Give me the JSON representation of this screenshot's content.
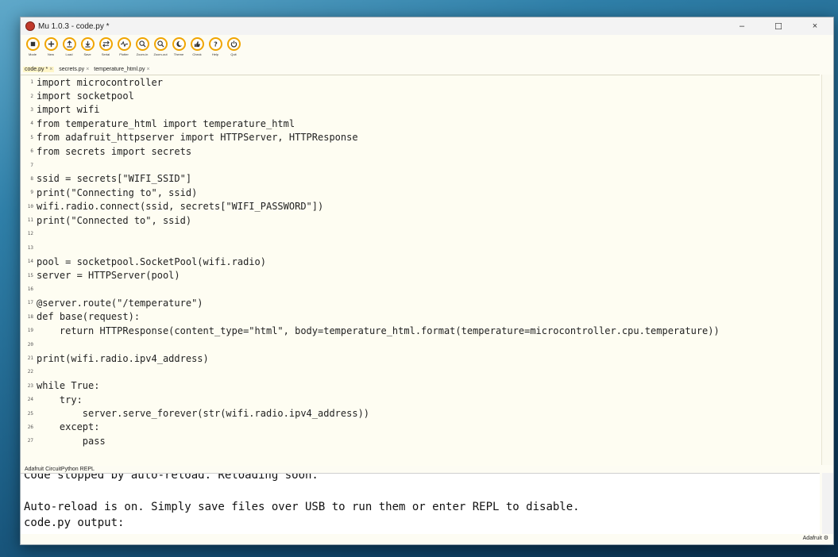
{
  "window": {
    "title": "Mu 1.0.3 - code.py *",
    "controls": [
      "–",
      "☐",
      "×"
    ]
  },
  "toolbar": [
    {
      "label": "Mode",
      "icon": "mode-icon"
    },
    {
      "label": "New",
      "icon": "plus-icon"
    },
    {
      "label": "Load",
      "icon": "load-icon"
    },
    {
      "label": "Save",
      "icon": "save-icon"
    },
    {
      "label": "Serial",
      "icon": "serial-icon"
    },
    {
      "label": "Plotter",
      "icon": "plotter-icon"
    },
    {
      "label": "Zoom-in",
      "icon": "zoom-in-icon"
    },
    {
      "label": "Zoom-out",
      "icon": "zoom-out-icon"
    },
    {
      "label": "Theme",
      "icon": "theme-icon"
    },
    {
      "label": "Check",
      "icon": "check-icon"
    },
    {
      "label": "Help",
      "icon": "help-icon"
    },
    {
      "label": "Quit",
      "icon": "quit-icon"
    }
  ],
  "tabs": [
    {
      "label": "code.py *"
    },
    {
      "label": "secrets.py"
    },
    {
      "label": "temperature_html.py"
    }
  ],
  "code": [
    {
      "n": "1",
      "text": "import microcontroller"
    },
    {
      "n": "2",
      "text": "import socketpool"
    },
    {
      "n": "3",
      "text": "import wifi"
    },
    {
      "n": "4",
      "text": "from temperature_html import temperature_html"
    },
    {
      "n": "5",
      "text": "from adafruit_httpserver import HTTPServer, HTTPResponse"
    },
    {
      "n": "6",
      "text": "from secrets import secrets"
    },
    {
      "n": "7",
      "text": ""
    },
    {
      "n": "8",
      "text": "ssid = secrets[\"WIFI_SSID\"]"
    },
    {
      "n": "9",
      "text": "print(\"Connecting to\", ssid)"
    },
    {
      "n": "10",
      "text": "wifi.radio.connect(ssid, secrets[\"WIFI_PASSWORD\"])"
    },
    {
      "n": "11",
      "text": "print(\"Connected to\", ssid)"
    },
    {
      "n": "12",
      "text": ""
    },
    {
      "n": "13",
      "text": ""
    },
    {
      "n": "14",
      "text": "pool = socketpool.SocketPool(wifi.radio)"
    },
    {
      "n": "15",
      "text": "server = HTTPServer(pool)"
    },
    {
      "n": "16",
      "text": ""
    },
    {
      "n": "17",
      "text": "@server.route(\"/temperature\")"
    },
    {
      "n": "18",
      "text": "def base(request):"
    },
    {
      "n": "19",
      "text": "    return HTTPResponse(content_type=\"html\", body=temperature_html.format(temperature=microcontroller.cpu.temperature))"
    },
    {
      "n": "20",
      "text": ""
    },
    {
      "n": "21",
      "text": "print(wifi.radio.ipv4_address)"
    },
    {
      "n": "22",
      "text": ""
    },
    {
      "n": "23",
      "text": "while True:"
    },
    {
      "n": "24",
      "text": "    try:"
    },
    {
      "n": "25",
      "text": "        server.serve_forever(str(wifi.radio.ipv4_address))"
    },
    {
      "n": "26",
      "text": "    except:"
    },
    {
      "n": "27",
      "text": "        pass"
    }
  ],
  "repl": {
    "label": "Adafruit CircuitPython REPL",
    "lines": [
      "Code stopped by auto-reload. Reloading soon.",
      "",
      "Auto-reload is on. Simply save files over USB to run them or enter REPL to disable.",
      "code.py output:"
    ]
  },
  "status": {
    "mode": "Adafruit"
  }
}
